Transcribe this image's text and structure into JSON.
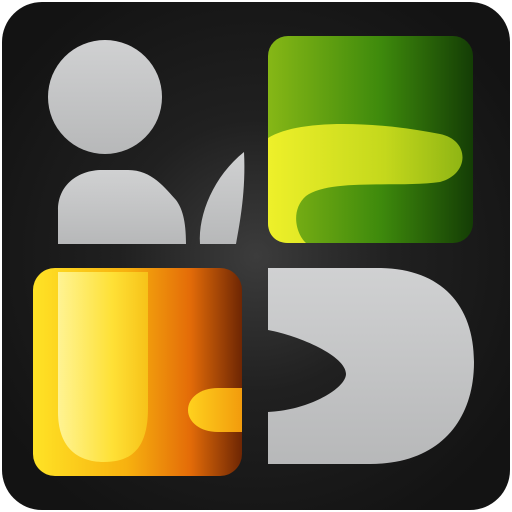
{
  "icon": {
    "name": "app-launcher-icon",
    "glyphs": [
      "person-icon",
      "leaf-icon",
      "green-tile-icon",
      "orange-tile-icon",
      "s-shape-icon"
    ],
    "colors": {
      "frame_dark": "#141414",
      "frame_center_glow": "#3a3a3a",
      "glyph_gray": "#c4c5c6",
      "green_light": "#8fbf14",
      "green_dark": "#1b4a06",
      "green_band_yellow": "#e3e81f",
      "orange_light": "#ffe82a",
      "orange_mid": "#f08a0a",
      "orange_dark": "#7a2a04"
    }
  }
}
